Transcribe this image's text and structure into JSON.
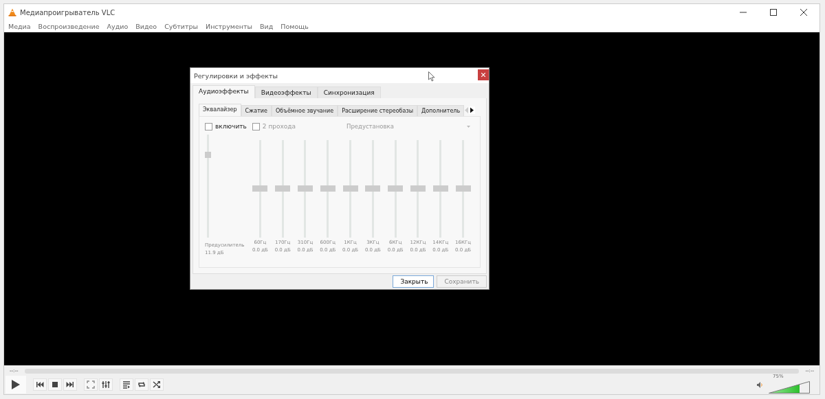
{
  "window": {
    "title": "Медиапроигрыватель VLC"
  },
  "menu": [
    "Медиа",
    "Воспроизведение",
    "Аудио",
    "Видео",
    "Субтитры",
    "Инструменты",
    "Вид",
    "Помощь"
  ],
  "dialog": {
    "title": "Регулировки и эффекты",
    "tabs": [
      {
        "label": "Аудиоэффекты",
        "selected": true
      },
      {
        "label": "Видеоэффекты",
        "selected": false
      },
      {
        "label": "Синхронизация",
        "selected": false
      }
    ],
    "subtabs": [
      {
        "label": "Эквалайзер",
        "selected": true
      },
      {
        "label": "Сжатие",
        "selected": false
      },
      {
        "label": "Объёмное звучание",
        "selected": false
      },
      {
        "label": "Расширение стереобазы",
        "selected": false
      },
      {
        "label": "Дополнитель",
        "selected": false
      }
    ],
    "enable": {
      "label": "включить",
      "checked": false,
      "disabled": false
    },
    "two_pass": {
      "label": "2 прохода",
      "checked": false,
      "disabled": true
    },
    "preset": {
      "placeholder": "Предустановка",
      "disabled": true
    },
    "preamp": {
      "label": "Предусилитель",
      "reading": "11.9 дБ",
      "level": 0.8
    },
    "bands": [
      {
        "freq": "60Гц",
        "reading": "0.0 дБ",
        "level": 0.5
      },
      {
        "freq": "170Гц",
        "reading": "0.0 дБ",
        "level": 0.5
      },
      {
        "freq": "310Гц",
        "reading": "0.0 дБ",
        "level": 0.5
      },
      {
        "freq": "600Гц",
        "reading": "0.0 дБ",
        "level": 0.5
      },
      {
        "freq": "1КГц",
        "reading": "0.0 дБ",
        "level": 0.5
      },
      {
        "freq": "3КГц",
        "reading": "0.0 дБ",
        "level": 0.5
      },
      {
        "freq": "6КГц",
        "reading": "0.0 дБ",
        "level": 0.5
      },
      {
        "freq": "12КГц",
        "reading": "0.0 дБ",
        "level": 0.5
      },
      {
        "freq": "14КГц",
        "reading": "0.0 дБ",
        "level": 0.5
      },
      {
        "freq": "16КГц",
        "reading": "0.0 дБ",
        "level": 0.5
      }
    ],
    "buttons": [
      {
        "label": "Закрыть",
        "disabled": false
      },
      {
        "label": "Сохранить",
        "disabled": true
      }
    ]
  },
  "player": {
    "elapsed": "--:--",
    "remaining": "--:--",
    "volume": {
      "reading": "75%",
      "level": 0.75
    }
  }
}
